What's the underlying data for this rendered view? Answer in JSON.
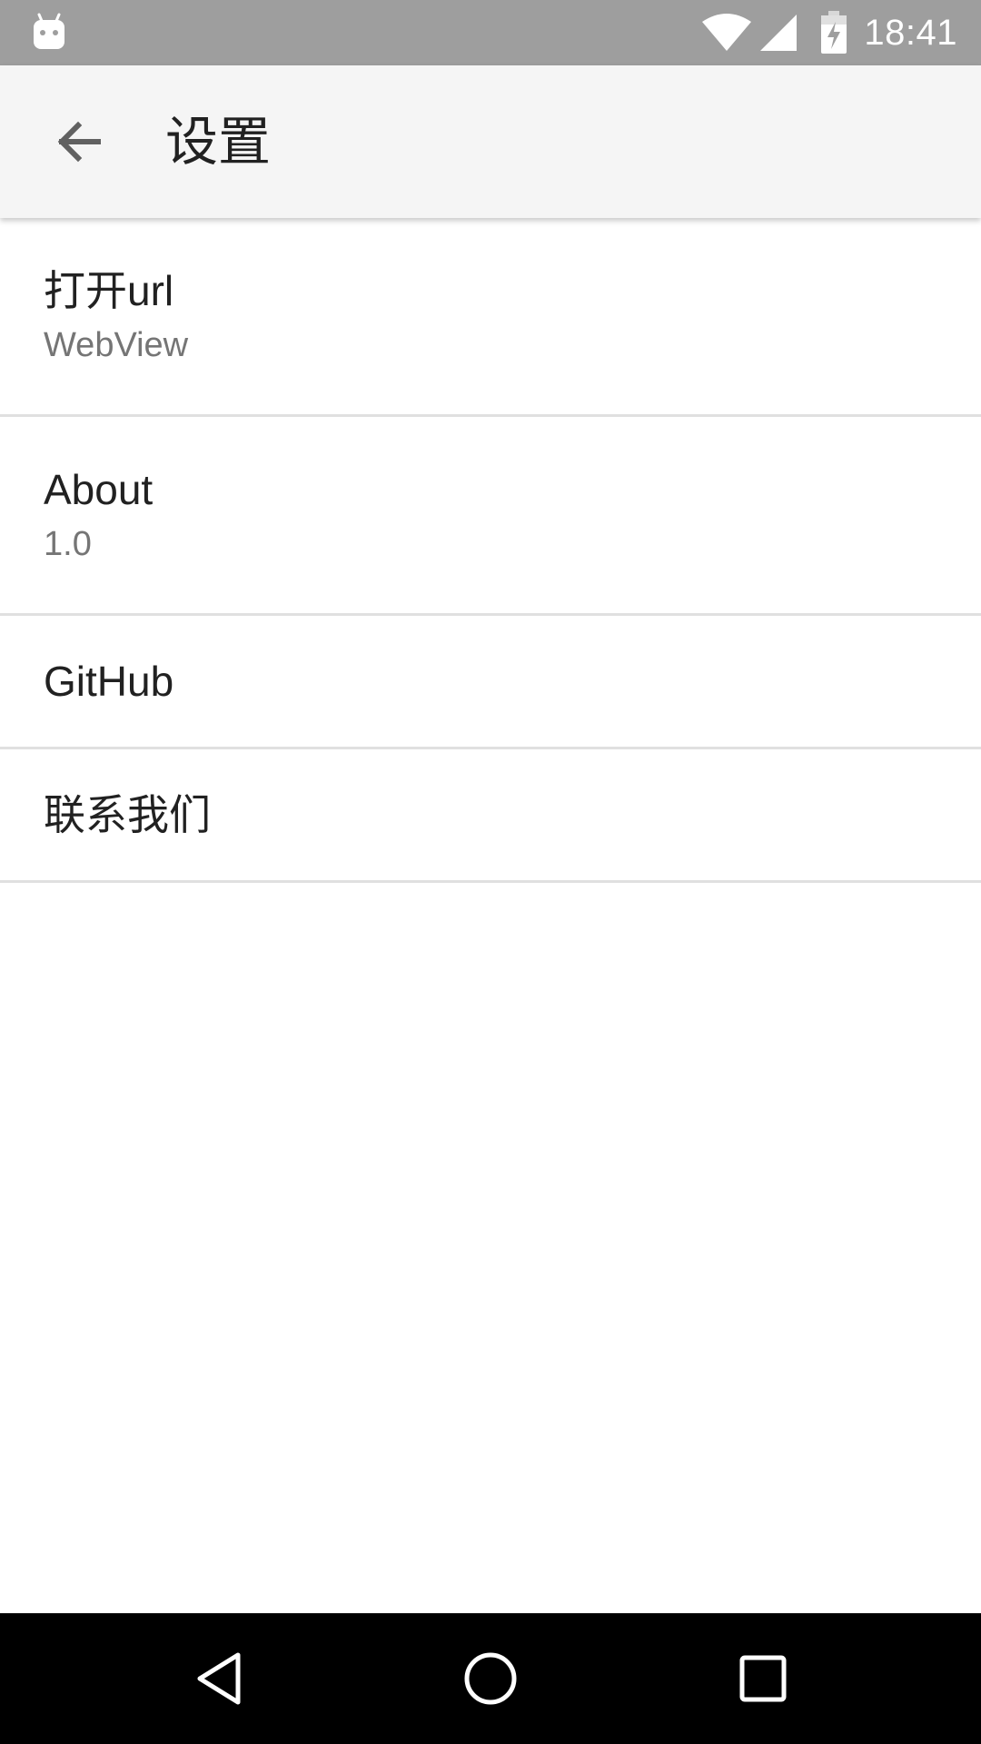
{
  "status_bar": {
    "time": "18:41",
    "left_icon": "android-debug-icon",
    "icons": [
      "wifi-icon",
      "signal-icon",
      "battery-charging-icon"
    ],
    "background": "#9e9e9e"
  },
  "app_bar": {
    "back_icon": "arrow-back-icon",
    "title": "设置",
    "background": "#f5f5f5"
  },
  "preferences": [
    {
      "title": "打开url",
      "summary": "WebView"
    },
    {
      "title": "About",
      "summary": "1.0"
    },
    {
      "title": "GitHub"
    },
    {
      "title": "联系我们"
    }
  ],
  "nav_bar": {
    "icons": [
      "nav-back-icon",
      "nav-home-icon",
      "nav-recents-icon"
    ],
    "background": "#000000"
  }
}
